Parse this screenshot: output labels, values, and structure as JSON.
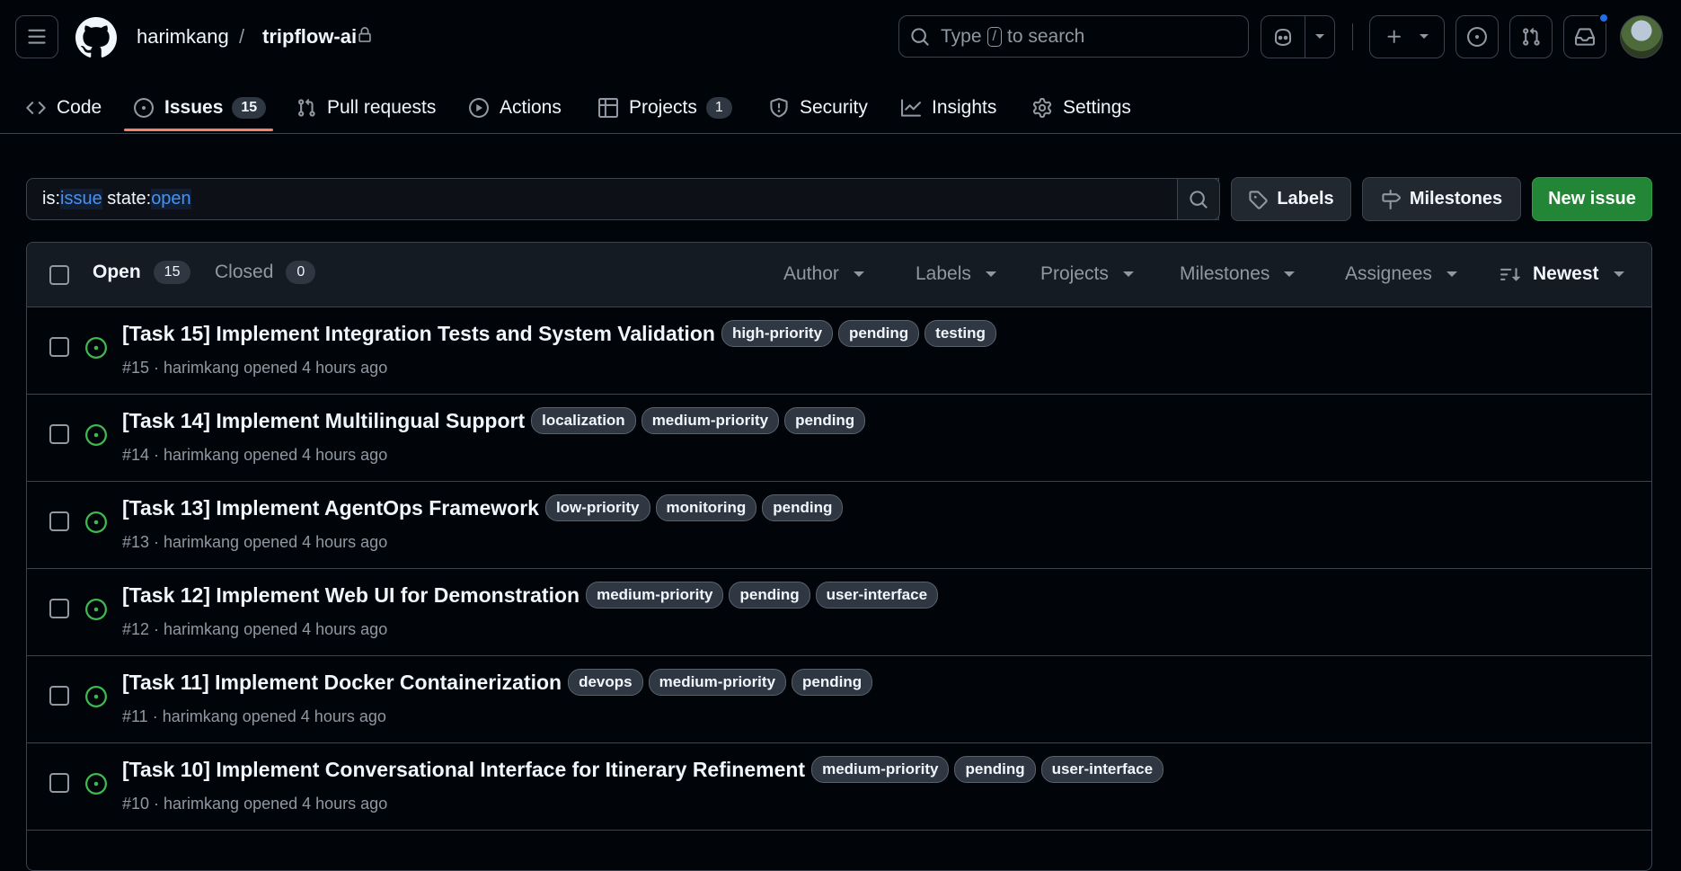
{
  "header": {
    "owner": "harimkang",
    "separator": "/",
    "repo": "tripflow-ai",
    "search_prefix": "Type",
    "search_key": "/",
    "search_suffix": "to search"
  },
  "nav": {
    "items": [
      {
        "label": "Code",
        "icon": "code-icon"
      },
      {
        "label": "Issues",
        "icon": "issue-opened-icon",
        "count": "15"
      },
      {
        "label": "Pull requests",
        "icon": "git-pull-request-icon"
      },
      {
        "label": "Actions",
        "icon": "play-icon"
      },
      {
        "label": "Projects",
        "icon": "table-icon",
        "count": "1"
      },
      {
        "label": "Security",
        "icon": "shield-icon"
      },
      {
        "label": "Insights",
        "icon": "graph-icon"
      },
      {
        "label": "Settings",
        "icon": "gear-icon"
      }
    ]
  },
  "filter": {
    "q1_key": "is:",
    "q1_val": "issue",
    "q2_key": "state:",
    "q2_val": "open",
    "labels_button": "Labels",
    "milestones_button": "Milestones",
    "new_issue_button": "New issue"
  },
  "list_header": {
    "open_label": "Open",
    "open_count": "15",
    "closed_label": "Closed",
    "closed_count": "0",
    "author": "Author",
    "labels": "Labels",
    "projects": "Projects",
    "milestones": "Milestones",
    "assignees": "Assignees",
    "sort": "Newest"
  },
  "issues": [
    {
      "title": "[Task 15] Implement Integration Tests and System Validation",
      "labels": [
        "high-priority",
        "pending",
        "testing"
      ],
      "meta": "#15 · harimkang opened 4 hours ago"
    },
    {
      "title": "[Task 14] Implement Multilingual Support",
      "labels": [
        "localization",
        "medium-priority",
        "pending"
      ],
      "meta": "#14 · harimkang opened 4 hours ago"
    },
    {
      "title": "[Task 13] Implement AgentOps Framework",
      "labels": [
        "low-priority",
        "monitoring",
        "pending"
      ],
      "meta": "#13 · harimkang opened 4 hours ago"
    },
    {
      "title": "[Task 12] Implement Web UI for Demonstration",
      "labels": [
        "medium-priority",
        "pending",
        "user-interface"
      ],
      "meta": "#12 · harimkang opened 4 hours ago"
    },
    {
      "title": "[Task 11] Implement Docker Containerization",
      "labels": [
        "devops",
        "medium-priority",
        "pending"
      ],
      "meta": "#11 · harimkang opened 4 hours ago"
    },
    {
      "title": "[Task 10] Implement Conversational Interface for Itinerary Refinement",
      "labels": [
        "medium-priority",
        "pending",
        "user-interface"
      ],
      "meta": "#10 · harimkang opened 4 hours ago"
    }
  ],
  "colors": {
    "background": "#010409",
    "border": "#3d444d",
    "accent_underline": "#f78166",
    "open_icon": "#3fb950",
    "primary_button": "#238636",
    "notification_dot": "#1f6feb"
  }
}
